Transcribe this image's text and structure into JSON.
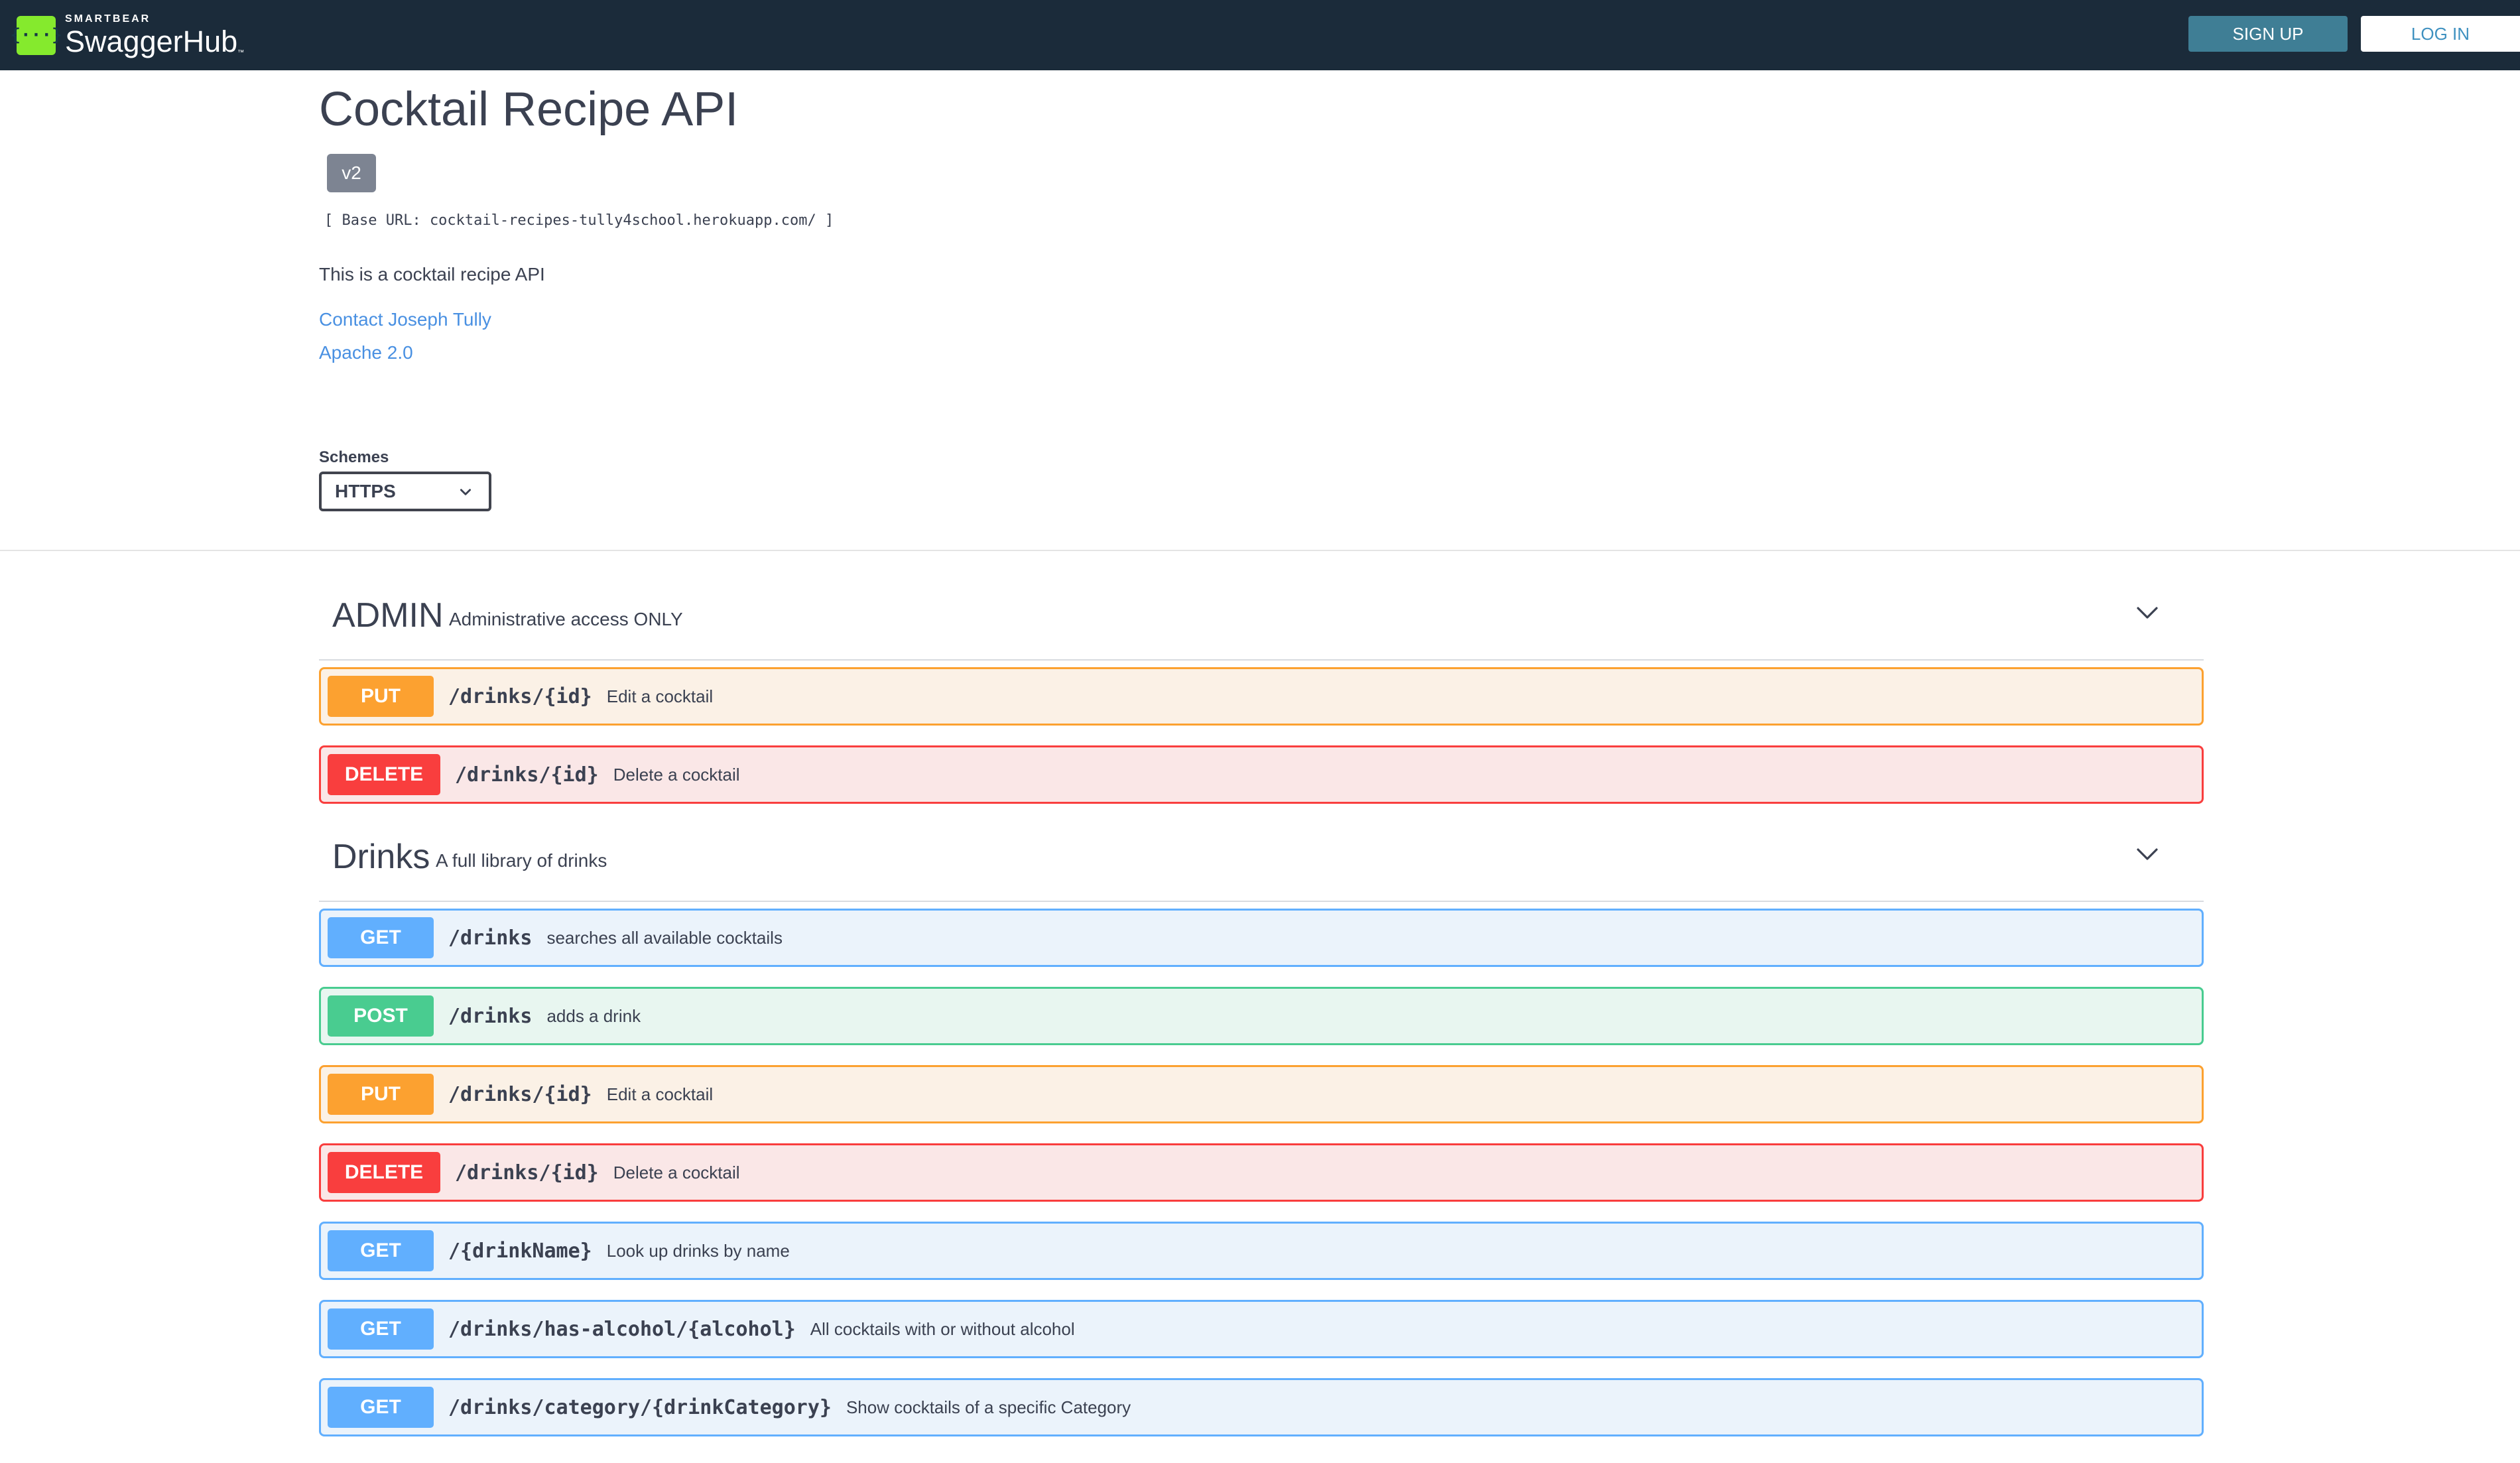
{
  "topbar": {
    "brand": "SMARTBEAR",
    "product": "SwaggerHub",
    "trademark": "™",
    "logo_icon": "swagger-braces-icon",
    "logo_glyph": "{···}",
    "signup_label": "SIGN UP",
    "login_label": "LOG IN"
  },
  "info": {
    "title": "Cocktail Recipe API",
    "version": "v2",
    "base_url": "[ Base URL: cocktail-recipes-tully4school.herokuapp.com/ ]",
    "description": "This is a cocktail recipe API",
    "contact_link": "Contact Joseph Tully",
    "license_link": "Apache 2.0"
  },
  "schemes": {
    "label": "Schemes",
    "selected": "HTTPS"
  },
  "tags": [
    {
      "name": "ADMIN",
      "description": "Administrative access ONLY",
      "operations": [
        {
          "method": "PUT",
          "path": "/drinks/{id}",
          "summary": "Edit a cocktail"
        },
        {
          "method": "DELETE",
          "path": "/drinks/{id}",
          "summary": "Delete a cocktail"
        }
      ]
    },
    {
      "name": "Drinks",
      "description": "A full library of drinks",
      "operations": [
        {
          "method": "GET",
          "path": "/drinks",
          "summary": "searches all available cocktails"
        },
        {
          "method": "POST",
          "path": "/drinks",
          "summary": "adds a drink"
        },
        {
          "method": "PUT",
          "path": "/drinks/{id}",
          "summary": "Edit a cocktail"
        },
        {
          "method": "DELETE",
          "path": "/drinks/{id}",
          "summary": "Delete a cocktail"
        },
        {
          "method": "GET",
          "path": "/{drinkName}",
          "summary": "Look up drinks by name"
        },
        {
          "method": "GET",
          "path": "/drinks/has-alcohol/{alcohol}",
          "summary": "All cocktails with or without alcohol"
        },
        {
          "method": "GET",
          "path": "/drinks/category/{drinkCategory}",
          "summary": "Show cocktails of a specific Category"
        }
      ]
    }
  ],
  "colors": {
    "topbar_bg": "#1b2b3a",
    "logo_green": "#85ea2d",
    "get": "#61affe",
    "post": "#49cc90",
    "put": "#fca130",
    "delete": "#f93e3e",
    "link": "#4990e2"
  }
}
